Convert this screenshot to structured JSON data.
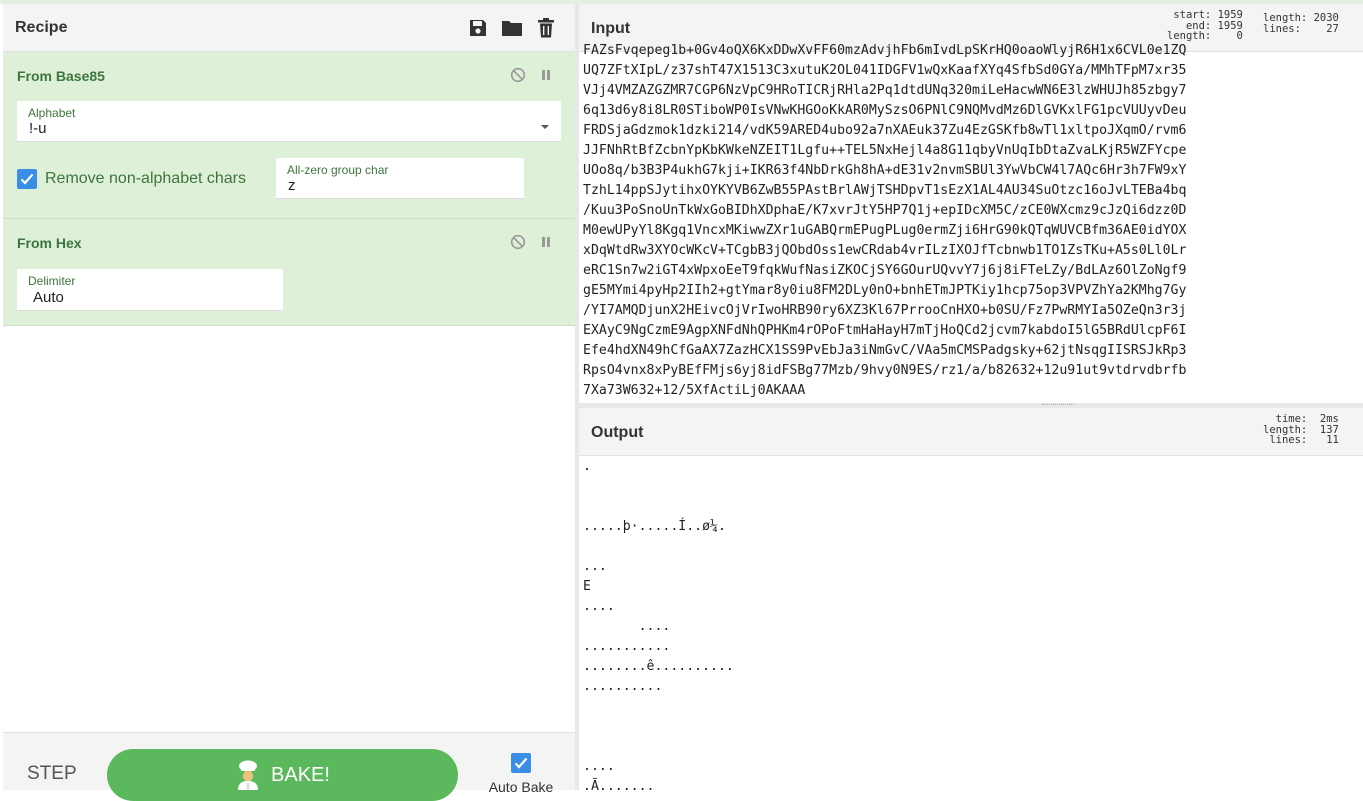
{
  "recipe": {
    "title": "Recipe",
    "icons": [
      "save-icon",
      "folder-icon",
      "trash-icon"
    ],
    "operations": [
      {
        "name": "From Base85",
        "alphabet_label": "Alphabet",
        "alphabet_value": "!-u",
        "remove_label": "Remove non-alphabet chars",
        "zero_label": "All-zero group char",
        "zero_value": "z"
      },
      {
        "name": "From Hex",
        "delimiter_label": "Delimiter",
        "delimiter_value": "Auto"
      }
    ],
    "step_label": "STEP",
    "bake_label": "BAKE!",
    "autobake_label": "Auto Bake"
  },
  "input": {
    "title": "Input",
    "stats_left": "start: 1959\nend: 1959\nlength:    0",
    "stats_right": "length: 2030\nlines:    27",
    "lines": [
      "FAZsFvqepeg1b+0Gv4oQX6KxDDwXvFF60mzAdvjhFb6mIvdLpSKrHQ0oaoWlyjR6H1x6CVL0e1ZQ",
      "UQ7ZFtXIpL/z37shT47X1513C3xutuK2OL041IDGFV1wQxKaafXYq4SfbSd0GYa/MMhTFpM7xr35",
      "VJj4VMZAZGZMR7CGP6NzVpC9HRoTICRjRHla2Pq1dtdUNq320miLeHacwWN6E3lzWHUJh85zbgy7",
      "6q13d6y8i8LR0STiboWP0IsVNwKHGOoKkAR0MySzsO6PNlC9NQMvdMz6DlGVKxlFG1pcVUUyvDeu",
      "FRDSjaGdzmok1dzki214/vdK59ARED4ubo92a7nXAEuk37Zu4EzGSKfb8wTl1xltpoJXqmO/rvm6",
      "JJFNhRtBfZcbnYpKbKWkeNZEIT1Lgfu++TEL5NxHejl4a8G11qbyVnUqIbDtaZvaLKjR5WZFYcpe",
      "UOo8q/b3B3P4ukhG7kji+IKR63f4NbDrkGh8hA+dE31v2nvmSBUl3YwVbCW4l7AQc6Hr3h7FW9xY",
      "TzhL14ppSJytihxOYKYVB6ZwB55PAstBrlAWjTSHDpvT1sEzX1AL4AU34SuOtzc16oJvLTEBa4bq",
      "/Kuu3PoSnoUnTkWxGoBIDhXDphaE/K7xvrJtY5HP7Q1j+epIDcXM5C/zCE0WXcmz9cJzQi6dzz0D",
      "M0ewUPyYl8Kgq1VncxMKiwwZXr1uGABQrmEPugPLug0ermZji6HrG90kQTqWUVCBfm36AE0idYOX",
      "xDqWtdRw3XYOcWKcV+TCgbB3jQObdOss1ewCRdab4vrILzIXOJfTcbnwb1TO1ZsTKu+A5s0Ll0Lr",
      "eRC1Sn7w2iGT4xWpxoEeT9fqkWufNasiZKOCjSY6GOurUQvvY7j6j8iFTeLZy/BdLAz6OlZoNgf9",
      "gE5MYmi4pyHp2IIh2+gtYmar8y0iu8FM2DLy0nO+bnhETmJPTKiy1hcp75op3VPVZhYa2KMhg7Gy",
      "/YI7AMQDjunX2HEivcOjVrIwoHRB90ry6XZ3Kl67PrrooCnHXO+b0SU/Fz7PwRMYIa5OZeQn3r3j",
      "EXAyC9NgCzmE9AgpXNFdNhQPHKm4rOPoFtmHaHayH7mTjHoQCd2jcvm7kabdoI5lG5BRdUlcpF6I",
      "Efe4hdXN49hCfGaAX7ZazHCX1SS9PvEbJa3iNmGvC/VAa5mCMSPadgsky+62jtNsqgIISRSJkRp3",
      "RpsO4vnx8xPyBEfFMjs6yj8idFSBg77Mzb/9hvy0N9ES/rz1/a/b82632+12u91ut9vtdrvdbrfb",
      "7Xa73W632+12/5XfActiLj0AKAAA"
    ]
  },
  "output": {
    "title": "Output",
    "stats": "time:  2ms\nlength:  137\nlines:   11",
    "lines": [
      ".",
      "",
      "",
      ".....þ·.....Í..ø¼.",
      "",
      "...",
      "E",
      "....",
      "       ....",
      "...........",
      "........ê..........",
      "..........",
      "",
      "",
      "",
      "....",
      ".Ã......."
    ]
  }
}
